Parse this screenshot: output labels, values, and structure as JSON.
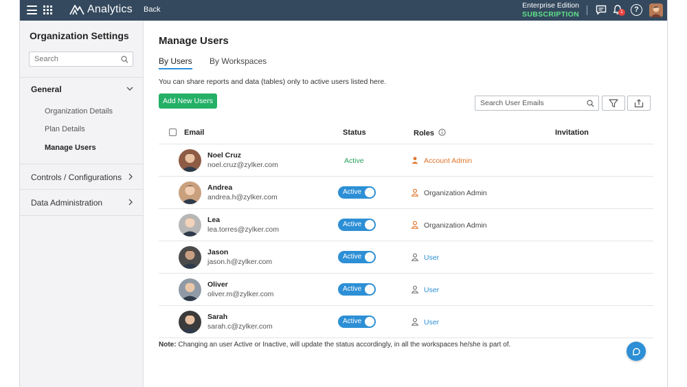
{
  "topbar": {
    "app_name": "Analytics",
    "back_label": "Back",
    "edition": "Enterprise Edition",
    "subscription": "SUBSCRIPTION",
    "notification_count": "1",
    "help_glyph": "?",
    "icons": [
      "menu-icon",
      "apps-grid-icon",
      "analytics-logo",
      "chat-icon",
      "bell-icon",
      "help-icon",
      "avatar"
    ]
  },
  "sidebar": {
    "title": "Organization Settings",
    "search_placeholder": "Search",
    "sections": [
      {
        "label": "General",
        "expanded": true,
        "items": [
          {
            "label": "Organization Details"
          },
          {
            "label": "Plan Details"
          },
          {
            "label": "Manage Users",
            "active": true
          }
        ]
      },
      {
        "label": "Controls / Configurations",
        "expanded": false
      },
      {
        "label": "Data Administration",
        "expanded": false
      }
    ]
  },
  "main": {
    "title": "Manage Users",
    "tabs": [
      {
        "label": "By Users",
        "active": true
      },
      {
        "label": "By Workspaces",
        "active": false
      }
    ],
    "info": "You can share reports and data (tables) only to active users listed here.",
    "add_button": "Add New Users",
    "email_search_placeholder": "Search User Emails",
    "columns": {
      "email": "Email",
      "status": "Status",
      "roles": "Roles",
      "invitation": "Invitation"
    },
    "users": [
      {
        "name": "Noel Cruz",
        "email": "noel.cruz@zylker.com",
        "status": "Active",
        "status_style": "text",
        "role": "Account Admin",
        "role_type": "account"
      },
      {
        "name": "Andrea",
        "email": "andrea.h@zylker.com",
        "status": "Active",
        "status_style": "toggle",
        "role": "Organization Admin",
        "role_type": "org"
      },
      {
        "name": "Lea",
        "email": "lea.torres@zylker.com",
        "status": "Active",
        "status_style": "toggle",
        "role": "Organization Admin",
        "role_type": "org"
      },
      {
        "name": "Jason",
        "email": "jason.h@zylker.com",
        "status": "Active",
        "status_style": "toggle",
        "role": "User",
        "role_type": "user"
      },
      {
        "name": "Oliver",
        "email": "oliver.m@zylker.com",
        "status": "Active",
        "status_style": "toggle",
        "role": "User",
        "role_type": "user"
      },
      {
        "name": "Sarah",
        "email": "sarah.c@zylker.com",
        "status": "Active",
        "status_style": "toggle",
        "role": "User",
        "role_type": "user"
      }
    ],
    "note_label": "Note:",
    "note_text": " Changing an user Active or Inactive, will update the status accordingly, in all the workspaces he/she is part of."
  },
  "colors": {
    "topbar": "#34495e",
    "accent_blue": "#2d8fd5",
    "green": "#25b068",
    "orange": "#e0752b"
  }
}
